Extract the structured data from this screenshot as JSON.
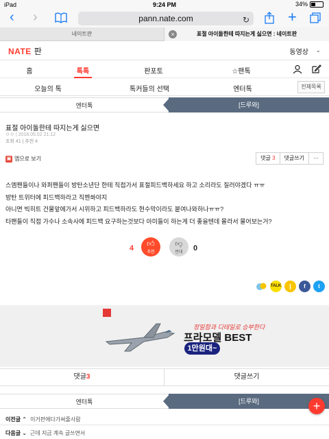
{
  "status": {
    "device": "iPad",
    "time": "9:24 PM",
    "battery": "34%",
    "battery_level": 0.34
  },
  "browser": {
    "url": "pann.nate.com",
    "tabs": [
      "네이트판",
      "표절 아이돌한테 따지는게 싫으면 : 네이트판"
    ]
  },
  "header": {
    "logo": "NATE",
    "section": "판",
    "user": "동영상"
  },
  "main_nav": [
    "홈",
    "톡톡",
    "판포토",
    "팬톡"
  ],
  "sub_nav": [
    "오늘의 톡",
    "톡커들의 선택",
    "엔터톡"
  ],
  "full_list": "전체목록",
  "segment": {
    "left": "엔터톡",
    "right": "[드루와]"
  },
  "post": {
    "title": "표절 아이돌한테 따지는게 싫으면",
    "meta1": "ㅇㅇ  | 2018.05.02 21:12",
    "meta2": "조회 41 | 추천 4",
    "app_view": "앱으로 보기",
    "comment_label": "댓글",
    "comment_count": "3",
    "write_comment": "댓글쓰기",
    "more": "···",
    "lines": [
      "스엠팬들이나 와퍼팬들이 방탄소년단 한테 직접가서 표절피드백하세요 하고 소리라도 질러야겠다 ㅠㅠ",
      "방탄 트위터에 피드백하라고 직멘쏴야지",
      "아니면 빅히트 건물앞에가서 시위하고 피드백하라도 현수막이라도 붙여나와하나ㅠㅠ?",
      "타팬들이 직접 가수나 소속사에 피드백 요구하는것보다 아미들이 하는게 더 좋을텐데 몰라서 물어보는거?"
    ]
  },
  "votes": {
    "up": "4",
    "up_label": "추천",
    "down": "0",
    "down_label": "반대"
  },
  "share": [
    "kakaostory",
    "talk",
    "kakao",
    "facebook",
    "twitter"
  ],
  "ad": {
    "line1": "정밀함과 디테일로 승부한다",
    "line2": "프라모델 BEST",
    "pill": "1만원대~"
  },
  "bottom": {
    "comment_label": "댓글",
    "comment_count": "3",
    "write_comment": "댓글쓰기"
  },
  "prev": {
    "label": "이전글 ⌃",
    "title": "이거판에다가써줄사람"
  },
  "next": {
    "label": "다음글 ⌄",
    "title": "근데 지금 계속 글쓰면서"
  },
  "colors": {
    "accent": "#ff3b30",
    "segment": "#5a6b80",
    "ios_blue": "#1a7cf5"
  }
}
